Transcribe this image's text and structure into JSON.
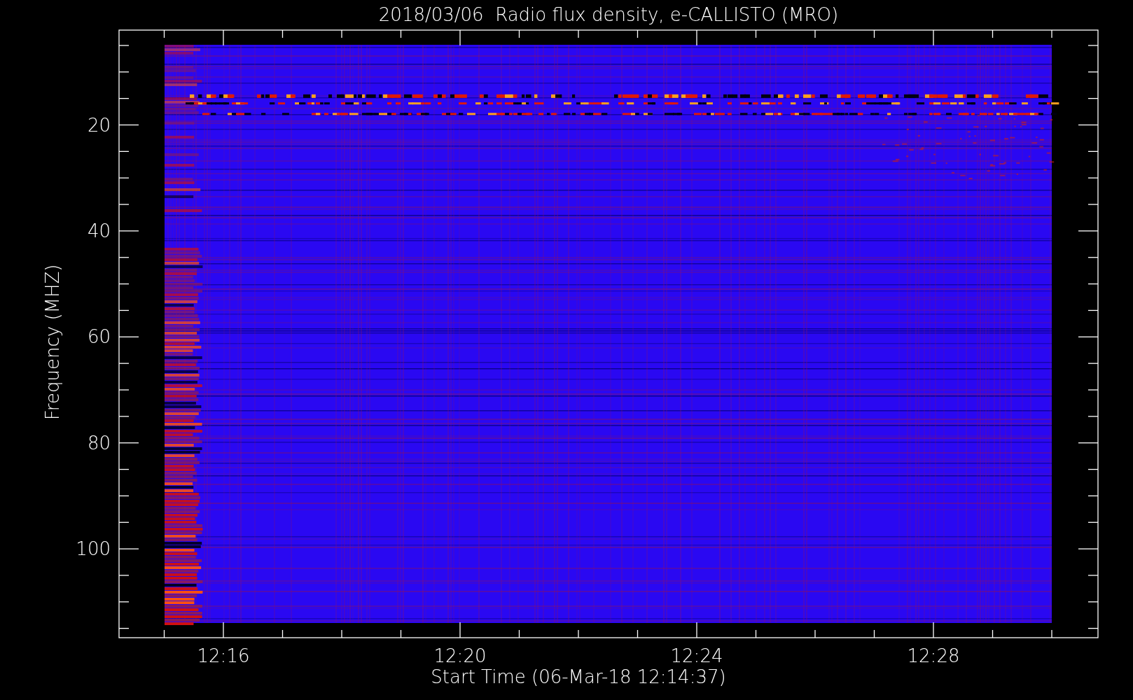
{
  "title": "2018/03/06  Radio flux density, e-CALLISTO (MRO)",
  "y_axis": {
    "label": "Frequency (MHZ)",
    "ticks": [
      "20",
      "40",
      "60",
      "80",
      "100"
    ]
  },
  "x_axis": {
    "label": "Start Time (06-Mar-18 12:14:37)",
    "ticks": [
      "12:16",
      "12:20",
      "12:24",
      "12:28"
    ]
  }
}
